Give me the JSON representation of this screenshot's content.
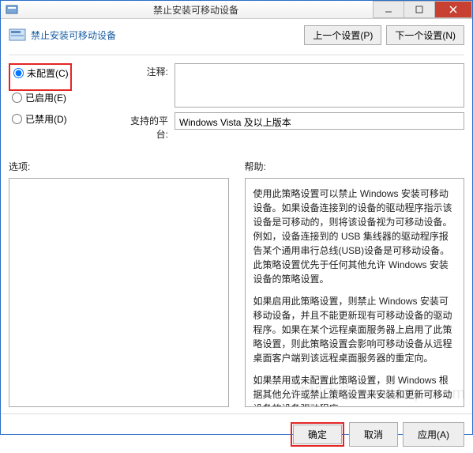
{
  "titlebar": {
    "title": "禁止安装可移动设备"
  },
  "header": {
    "title": "禁止安装可移动设备",
    "prev": "上一个设置(P)",
    "next": "下一个设置(N)"
  },
  "radios": {
    "not_configured": "未配置(C)",
    "enabled": "已启用(E)",
    "disabled": "已禁用(D)"
  },
  "comment": {
    "label": "注释:"
  },
  "platform": {
    "label": "支持的平台:",
    "value": "Windows Vista 及以上版本"
  },
  "options": {
    "label": "选项:"
  },
  "help": {
    "label": "帮助:",
    "p1": "使用此策略设置可以禁止 Windows 安装可移动设备。如果设备连接到的设备的驱动程序指示该设备是可移动的，则将该设备视为可移动设备。例如，设备连接到的 USB 集线器的驱动程序报告某个通用串行总线(USB)设备是可移动设备。此策略设置优先于任何其他允许 Windows 安装设备的策略设置。",
    "p2": "如果启用此策略设置，则禁止 Windows 安装可移动设备，并且不能更新现有可移动设备的驱动程序。如果在某个远程桌面服务器上启用了此策略设置，则此策略设置会影响可移动设备从远程桌面客户端到该远程桌面服务器的重定向。",
    "p3": "如果禁用或未配置此策略设置，则 Windows 根据其他允许或禁止策略设置来安装和更新可移动设备的设备驱动程序。"
  },
  "footer": {
    "ok": "确定",
    "cancel": "取消",
    "apply": "应用(A)"
  },
  "watermark": "装机之家 www.lotpc.com"
}
